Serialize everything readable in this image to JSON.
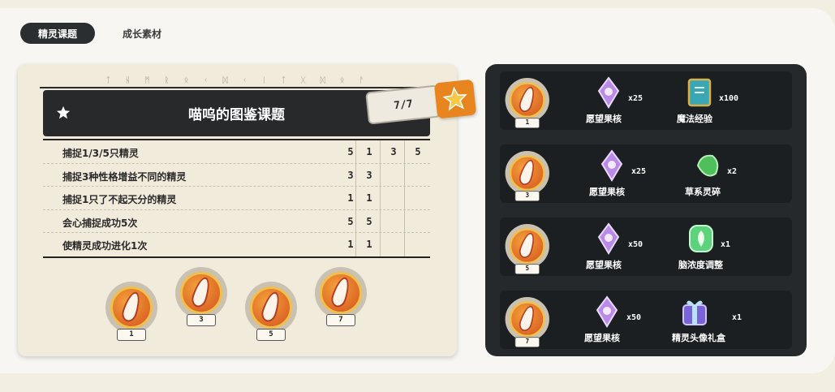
{
  "tabs": [
    {
      "label": "精灵课题",
      "active": true
    },
    {
      "label": "成长素材",
      "active": false
    }
  ],
  "left": {
    "rune_text": "ᛏ ᚺ ᛗ ᚱ ᛟ ᚲ ᛞ ᚲ ᛁ ᛏ ᚷ ᛞ ᛟ ᚨ",
    "title": "喵呜的图鉴课题",
    "progress": "7/7",
    "tasks": [
      {
        "label": "捕捉1/3/5只精灵",
        "cells": [
          "5",
          "1",
          "3",
          "5"
        ]
      },
      {
        "label": "捕捉3种性格增益不同的精灵",
        "cells": [
          "3",
          "3",
          "",
          ""
        ]
      },
      {
        "label": "捕捉1只了不起天分的精灵",
        "cells": [
          "1",
          "1",
          "",
          ""
        ]
      },
      {
        "label": "会心捕捉成功5次",
        "cells": [
          "5",
          "5",
          "",
          ""
        ]
      },
      {
        "label": "使精灵成功进化1次",
        "cells": [
          "1",
          "1",
          "",
          ""
        ]
      }
    ],
    "medals": [
      "1",
      "3",
      "5",
      "7"
    ]
  },
  "rewards": [
    {
      "medal": "1",
      "items": [
        {
          "name": "愿望果核",
          "qty": "x25",
          "icon": "wish-core-icon"
        },
        {
          "name": "魔法经验",
          "qty": "x100",
          "icon": "magic-book-icon"
        }
      ]
    },
    {
      "medal": "3",
      "items": [
        {
          "name": "愿望果核",
          "qty": "x25",
          "icon": "wish-core-icon"
        },
        {
          "name": "草系灵碎",
          "qty": "x2",
          "icon": "grass-shard-icon"
        }
      ]
    },
    {
      "medal": "5",
      "items": [
        {
          "name": "愿望果核",
          "qty": "x50",
          "icon": "wish-core-icon"
        },
        {
          "name": "脑浓度调整",
          "qty": "x1",
          "icon": "leaf-crystal-icon"
        }
      ]
    },
    {
      "medal": "7",
      "items": [
        {
          "name": "愿望果核",
          "qty": "x50",
          "icon": "wish-core-icon"
        },
        {
          "name": "精灵头像礼盒",
          "qty": "x1",
          "icon": "gift-box-icon"
        }
      ]
    }
  ],
  "colors": {
    "dark": "#27292b",
    "card": "#f1ebdc",
    "accent": "#e8851f"
  }
}
